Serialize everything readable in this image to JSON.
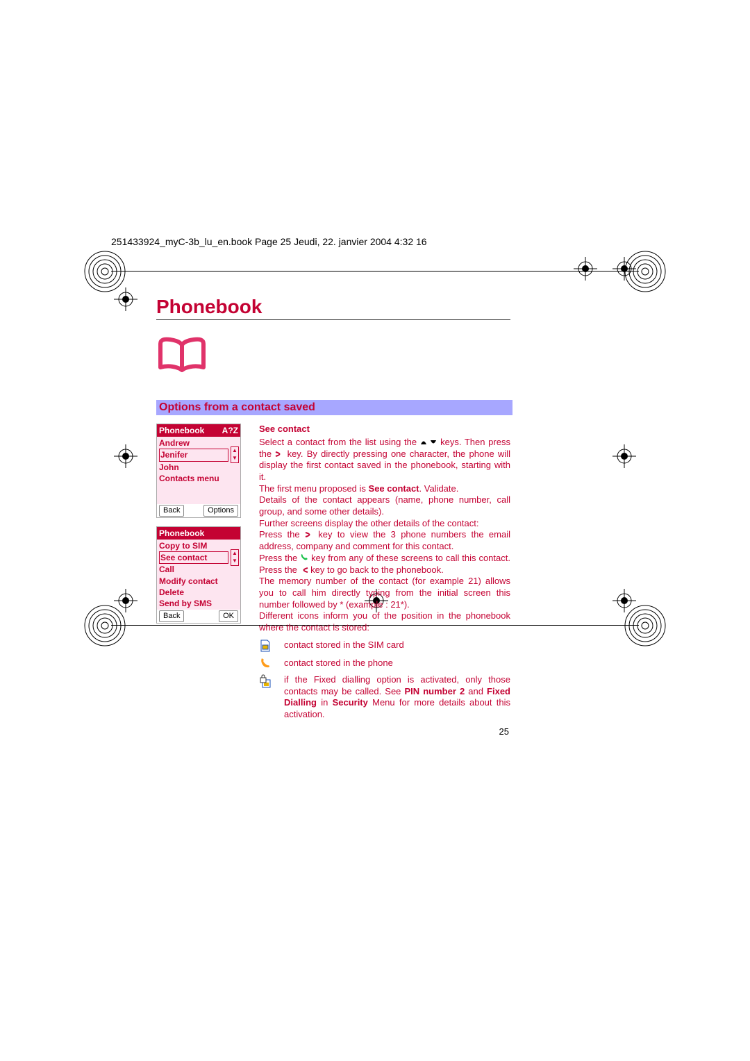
{
  "meta_header": "251433924_myC-3b_lu_en.book  Page 25  Jeudi, 22. janvier 2004  4:32 16",
  "chapter_title": "Phonebook",
  "section_title": "Options from a contact saved",
  "page_number": "25",
  "screen1": {
    "header_left": "Phonebook",
    "header_right": "A?Z",
    "items": [
      "Andrew",
      "Jenifer",
      "John",
      "Contacts menu"
    ],
    "selected_index": 1,
    "soft_left": "Back",
    "soft_right": "Options"
  },
  "screen2": {
    "header_left": "Phonebook",
    "items": [
      "Copy to SIM",
      "See contact",
      "Call",
      "Modify contact",
      "Delete",
      "Send by SMS"
    ],
    "selected_index": 1,
    "soft_left": "Back",
    "soft_right": "OK"
  },
  "body": {
    "sub_head": "See contact",
    "p1a": "Select a contact from the list using the ",
    "p1b": " keys. Then press the ",
    "p1c": " key. By directly pressing one character, the phone will display the first contact saved in the phonebook, starting with it.",
    "p2a": "The first menu proposed is ",
    "p2b": "See contact",
    "p2c": ". Validate.",
    "p3": "Details of the contact appears (name, phone number, call group, and some other details).",
    "p4": "Further screens display the other details of the contact:",
    "p5a": "Press the ",
    "p5b": " key to view the 3 phone numbers the email address, company and comment for this contact.",
    "p6a": "Press the ",
    "p6b": " key from any of these screens to call this contact. Press the ",
    "p6c": " key to go back to the phonebook.",
    "p7": "The memory number of the contact (for example 21) allows you to call him directly typing from the initial screen this number followed by * (example : 21*).",
    "p8": "Different icons inform you of the position in the phonebook where the contact is stored:",
    "legend1": "contact stored in the SIM card",
    "legend2": "contact stored in the phone",
    "legend3a": "if the Fixed dialling option is activated, only those contacts may be called. See ",
    "legend3b": "PIN number 2",
    "legend3c": " and ",
    "legend3d": "Fixed Dialling",
    "legend3e": " in ",
    "legend3f": "Security",
    "legend3g": " Menu for more details about this activation."
  }
}
